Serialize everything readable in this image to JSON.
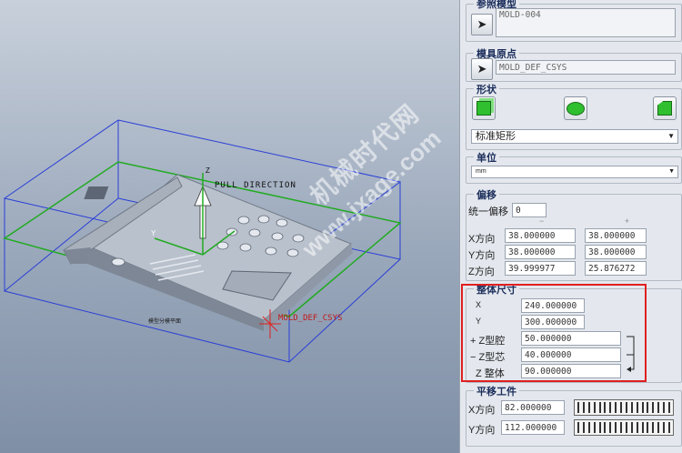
{
  "viewport": {
    "pull_direction_label": "PULL DIRECTION",
    "csys_label": "MOLD_DEF_CSYS",
    "axis_z": "Z",
    "axis_y": "Y",
    "parting_label": "模型分模平面"
  },
  "watermark": {
    "line1": "机械时代网",
    "line2": "www.jxage.com"
  },
  "ref_model": {
    "title": "参照模型",
    "value": "MOLD-004"
  },
  "mold_origin": {
    "title": "模具原点",
    "value": "MOLD_DEF_CSYS"
  },
  "shape": {
    "title": "形状",
    "selected": "标准矩形"
  },
  "unit": {
    "title": "单位",
    "selected": "mm"
  },
  "offset": {
    "title": "偏移",
    "uniform_label": "统一偏移",
    "uniform_value": "0",
    "minus_header": "−",
    "plus_header": "+",
    "rows": [
      {
        "label": "X方向",
        "minus": "38.000000",
        "plus": "38.000000"
      },
      {
        "label": "Y方向",
        "minus": "38.000000",
        "plus": "38.000000"
      },
      {
        "label": "Z方向",
        "minus": "39.999977",
        "plus": "25.876272"
      }
    ]
  },
  "overall": {
    "title": "整体尺寸",
    "x_label": "X",
    "x_value": "240.000000",
    "y_label": "Y",
    "y_value": "300.000000",
    "cavity_label": "+ Z型腔",
    "cavity_value": "50.000000",
    "core_label": "− Z型芯",
    "core_value": "40.000000",
    "total_label": "Z 整体",
    "total_value": "90.000000"
  },
  "translate": {
    "title": "平移工件",
    "x_label": "X方向",
    "x_value": "82.000000",
    "y_label": "Y方向",
    "y_value": "112.000000"
  },
  "colors": {
    "accent_red": "#e02020",
    "bbox_blue": "#2a3fd6",
    "plane_green": "#22aa22"
  }
}
